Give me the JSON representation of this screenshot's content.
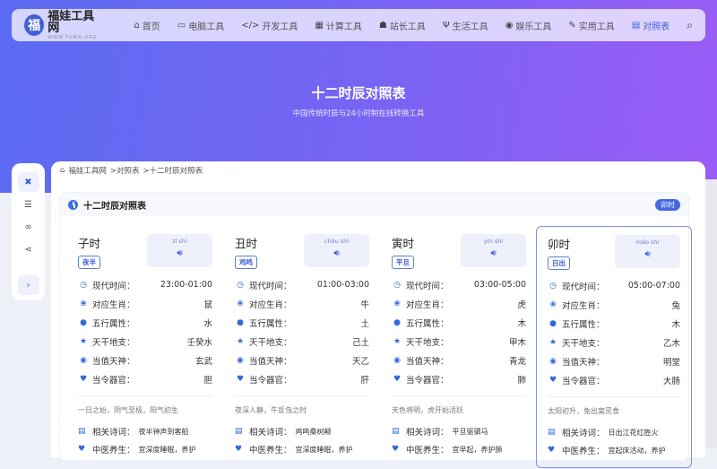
{
  "nav": {
    "logo_mark": "福",
    "logo_title": "福娃工具网",
    "logo_sub": "WWW.FUWA.ORG",
    "items": [
      {
        "label": "首页",
        "icon": "⌂"
      },
      {
        "label": "电脑工具",
        "icon": "▭"
      },
      {
        "label": "开发工具",
        "icon": "</>"
      },
      {
        "label": "计算工具",
        "icon": "▦"
      },
      {
        "label": "站长工具",
        "icon": "☗"
      },
      {
        "label": "生活工具",
        "icon": "Ψ"
      },
      {
        "label": "娱乐工具",
        "icon": "◉"
      },
      {
        "label": "实用工具",
        "icon": "✎"
      },
      {
        "label": "对照表",
        "icon": "▤"
      }
    ],
    "search_icon": "⌕"
  },
  "hero": {
    "title": "十二时辰对照表",
    "subtitle": "中国传统时辰与24小时制在线转换工具"
  },
  "breadcrumb": [
    "福娃工具网",
    ">对照表",
    ">十二时辰对照表"
  ],
  "panel": {
    "title": "十二时辰对照表",
    "current": "卯时"
  },
  "labels": {
    "time": "现代时间：",
    "zodiac": "对应生肖：",
    "element": "五行属性：",
    "stem": "天干地支：",
    "god": "当值天神：",
    "organ": "当令器官：",
    "poem": "相关诗词：",
    "tcm": "中医养生："
  },
  "cards": [
    {
      "name": "子时",
      "alias": "夜半",
      "pinyin": "zǐ shí",
      "time": "23:00-01:00",
      "zodiac": "鼠",
      "element": "水",
      "stem": "壬癸水",
      "god": "玄武",
      "organ": "胆",
      "desc": "一日之始，阴气至极，阳气初生",
      "poem": "夜半钟声到客船",
      "tcm": "宜深度睡眠，养护"
    },
    {
      "name": "丑时",
      "alias": "鸡鸣",
      "pinyin": "chǒu shí",
      "time": "01:00-03:00",
      "zodiac": "牛",
      "element": "土",
      "stem": "己土",
      "god": "天乙",
      "organ": "肝",
      "desc": "夜深人静，牛反刍之时",
      "poem": "鸡鸣桑树颠",
      "tcm": "宜深度睡眠，养护"
    },
    {
      "name": "寅时",
      "alias": "平旦",
      "pinyin": "yín shí",
      "time": "03:00-05:00",
      "zodiac": "虎",
      "element": "木",
      "stem": "甲木",
      "god": "青龙",
      "organ": "肺",
      "desc": "天色将明，虎开始活跃",
      "poem": "平旦驱驷马",
      "tcm": "宜早起，养护肺"
    },
    {
      "name": "卯时",
      "alias": "日出",
      "pinyin": "mǎo shí",
      "time": "05:00-07:00",
      "zodiac": "兔",
      "element": "木",
      "stem": "乙木",
      "god": "明堂",
      "organ": "大肠",
      "desc": "太阳初升，兔出窝觅食",
      "poem": "日出江花红胜火",
      "tcm": "宜起床活动，养护"
    }
  ],
  "colors": {
    "accent": "#3b5bdb",
    "hero_start": "#5a6cf2",
    "hero_end": "#9b5cf6"
  }
}
